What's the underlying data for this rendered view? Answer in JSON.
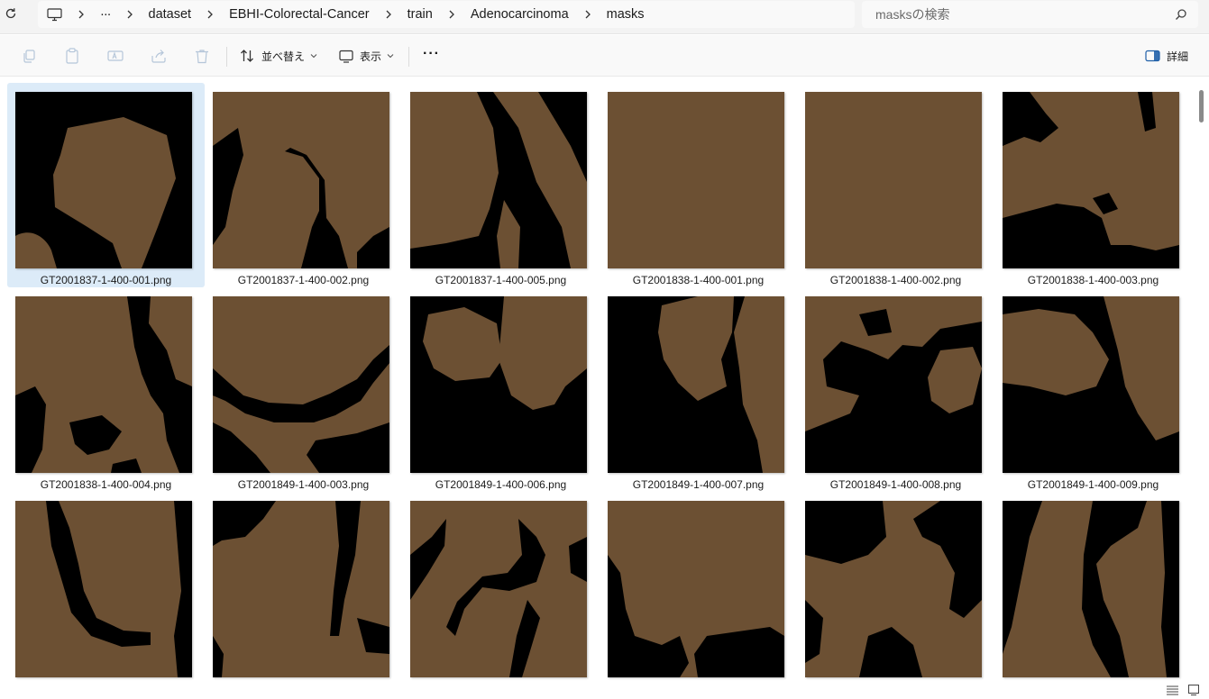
{
  "addressbar": {
    "breadcrumb": [
      "dataset",
      "EBHI-Colorectal-Cancer",
      "train",
      "Adenocarcinoma",
      "masks"
    ],
    "overflow_label": "···",
    "search_placeholder": "masksの検索"
  },
  "toolbar": {
    "sort_label": "並べ替え",
    "view_label": "表示",
    "more_label": "···",
    "details_label": "詳細"
  },
  "colors": {
    "mask_brown": "#6c5033",
    "background_black": "#000000",
    "selection": "#dcebf8"
  },
  "icons": [
    "refresh-icon",
    "this-pc-icon",
    "chevron-right-icon",
    "copy-icon",
    "paste-icon",
    "rename-icon",
    "share-icon",
    "delete-icon",
    "sort-icon",
    "view-icon",
    "more-icon",
    "details-pane-icon",
    "search-icon",
    "details-view-icon",
    "large-icons-view-icon"
  ],
  "files": [
    {
      "name": "GT2001837-1-400-001.png",
      "selected": true
    },
    {
      "name": "GT2001837-1-400-002.png"
    },
    {
      "name": "GT2001837-1-400-005.png"
    },
    {
      "name": "GT2001838-1-400-001.png"
    },
    {
      "name": "GT2001838-1-400-002.png"
    },
    {
      "name": "GT2001838-1-400-003.png"
    },
    {
      "name": "GT2001838-1-400-004.png"
    },
    {
      "name": "GT2001849-1-400-003.png"
    },
    {
      "name": "GT2001849-1-400-006.png"
    },
    {
      "name": "GT2001849-1-400-007.png"
    },
    {
      "name": "GT2001849-1-400-008.png"
    },
    {
      "name": "GT2001849-1-400-009.png"
    },
    {
      "name": ""
    },
    {
      "name": ""
    },
    {
      "name": ""
    },
    {
      "name": ""
    },
    {
      "name": ""
    },
    {
      "name": ""
    }
  ]
}
